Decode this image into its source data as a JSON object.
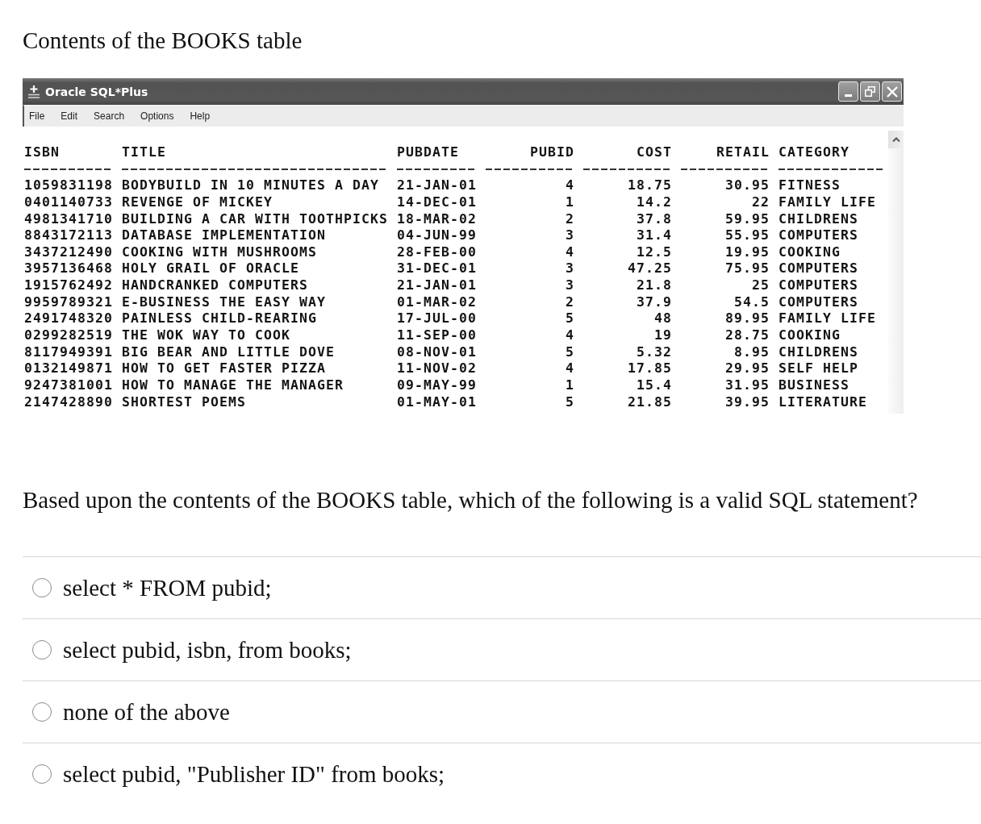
{
  "heading": "Contents of the BOOKS table",
  "window": {
    "title": "Oracle SQL*Plus",
    "menu": [
      "File",
      "Edit",
      "Search",
      "Options",
      "Help"
    ],
    "table": {
      "columns": [
        {
          "label": "ISBN",
          "kind": "text"
        },
        {
          "label": "TITLE",
          "kind": "text"
        },
        {
          "label": "PUBDATE",
          "kind": "text"
        },
        {
          "label": "PUBID",
          "kind": "number"
        },
        {
          "label": "COST",
          "kind": "number"
        },
        {
          "label": "RETAIL",
          "kind": "number"
        },
        {
          "label": "CATEGORY",
          "kind": "text"
        }
      ],
      "rows": [
        [
          "1059831198",
          "BODYBUILD IN 10 MINUTES A DAY",
          "21-JAN-01",
          "4",
          "18.75",
          "30.95",
          "FITNESS"
        ],
        [
          "0401140733",
          "REVENGE OF MICKEY",
          "14-DEC-01",
          "1",
          "14.2",
          "22",
          "FAMILY LIFE"
        ],
        [
          "4981341710",
          "BUILDING A CAR WITH TOOTHPICKS",
          "18-MAR-02",
          "2",
          "37.8",
          "59.95",
          "CHILDRENS"
        ],
        [
          "8843172113",
          "DATABASE IMPLEMENTATION",
          "04-JUN-99",
          "3",
          "31.4",
          "55.95",
          "COMPUTERS"
        ],
        [
          "3437212490",
          "COOKING WITH MUSHROOMS",
          "28-FEB-00",
          "4",
          "12.5",
          "19.95",
          "COOKING"
        ],
        [
          "3957136468",
          "HOLY GRAIL OF ORACLE",
          "31-DEC-01",
          "3",
          "47.25",
          "75.95",
          "COMPUTERS"
        ],
        [
          "1915762492",
          "HANDCRANKED COMPUTERS",
          "21-JAN-01",
          "3",
          "21.8",
          "25",
          "COMPUTERS"
        ],
        [
          "9959789321",
          "E-BUSINESS THE EASY WAY",
          "01-MAR-02",
          "2",
          "37.9",
          "54.5",
          "COMPUTERS"
        ],
        [
          "2491748320",
          "PAINLESS CHILD-REARING",
          "17-JUL-00",
          "5",
          "48",
          "89.95",
          "FAMILY LIFE"
        ],
        [
          "0299282519",
          "THE WOK WAY TO COOK",
          "11-SEP-00",
          "4",
          "19",
          "28.75",
          "COOKING"
        ],
        [
          "8117949391",
          "BIG BEAR AND LITTLE DOVE",
          "08-NOV-01",
          "5",
          "5.32",
          "8.95",
          "CHILDRENS"
        ],
        [
          "0132149871",
          "HOW TO GET FASTER PIZZA",
          "11-NOV-02",
          "4",
          "17.85",
          "29.95",
          "SELF HELP"
        ],
        [
          "9247381001",
          "HOW TO MANAGE THE MANAGER",
          "09-MAY-99",
          "1",
          "15.4",
          "31.95",
          "BUSINESS"
        ],
        [
          "2147428890",
          "SHORTEST POEMS",
          "01-MAY-01",
          "5",
          "21.85",
          "39.95",
          "LITERATURE"
        ]
      ]
    }
  },
  "question": "Based upon the contents of the BOOKS table, which of the following is a valid SQL statement?",
  "options": [
    {
      "label": "select * FROM pubid;",
      "selected": false
    },
    {
      "label": "select pubid, isbn, from books;",
      "selected": false
    },
    {
      "label": "none of the above",
      "selected": false
    },
    {
      "label": "select pubid, \"Publisher ID\" from books;",
      "selected": false
    }
  ]
}
